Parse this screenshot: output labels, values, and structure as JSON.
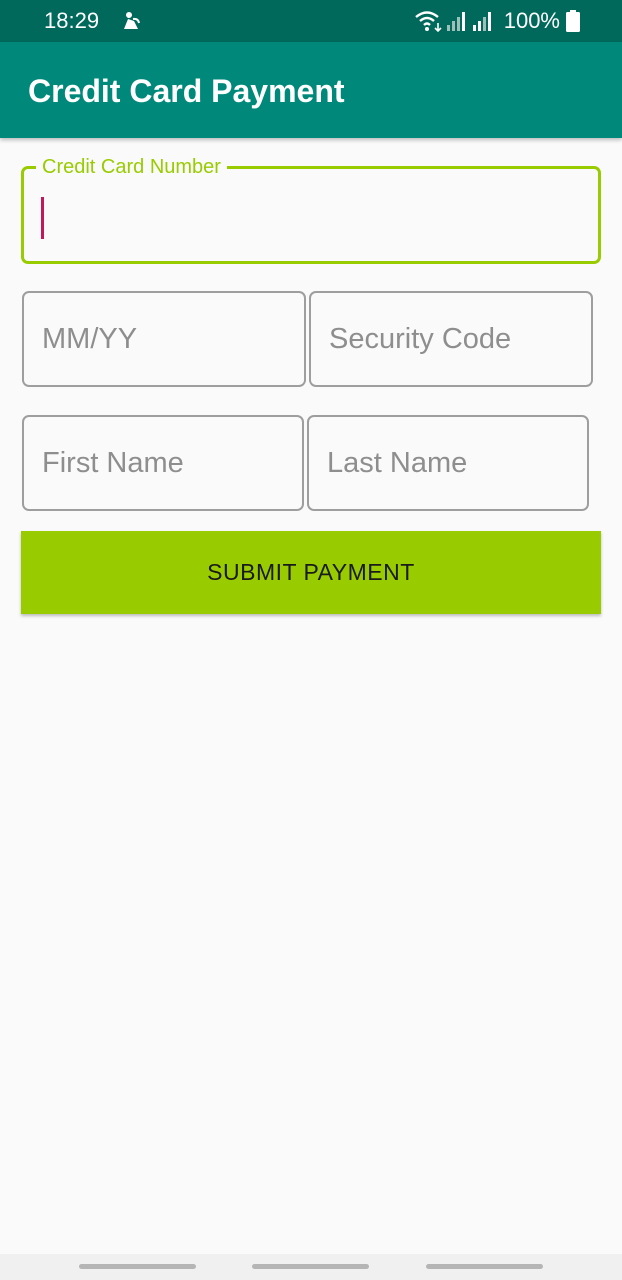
{
  "status_bar": {
    "time": "18:29",
    "battery": "100%",
    "icons": [
      "notification-icon",
      "wifi-icon",
      "signal-icon",
      "signal-icon",
      "battery-icon"
    ]
  },
  "app_bar": {
    "title": "Credit Card Payment"
  },
  "form": {
    "card_number": {
      "label": "Credit Card Number",
      "value": "",
      "placeholder": ""
    },
    "expiry": {
      "placeholder": "MM/YY",
      "value": ""
    },
    "security_code": {
      "placeholder": "Security Code",
      "value": ""
    },
    "first_name": {
      "placeholder": "First Name",
      "value": ""
    },
    "last_name": {
      "placeholder": "Last Name",
      "value": ""
    },
    "submit_label": "SUBMIT PAYMENT"
  },
  "colors": {
    "status_bar": "#00695c",
    "app_bar": "#00897b",
    "accent": "#99cc00",
    "caret": "#c2185b",
    "field_border": "#9e9e9e"
  }
}
